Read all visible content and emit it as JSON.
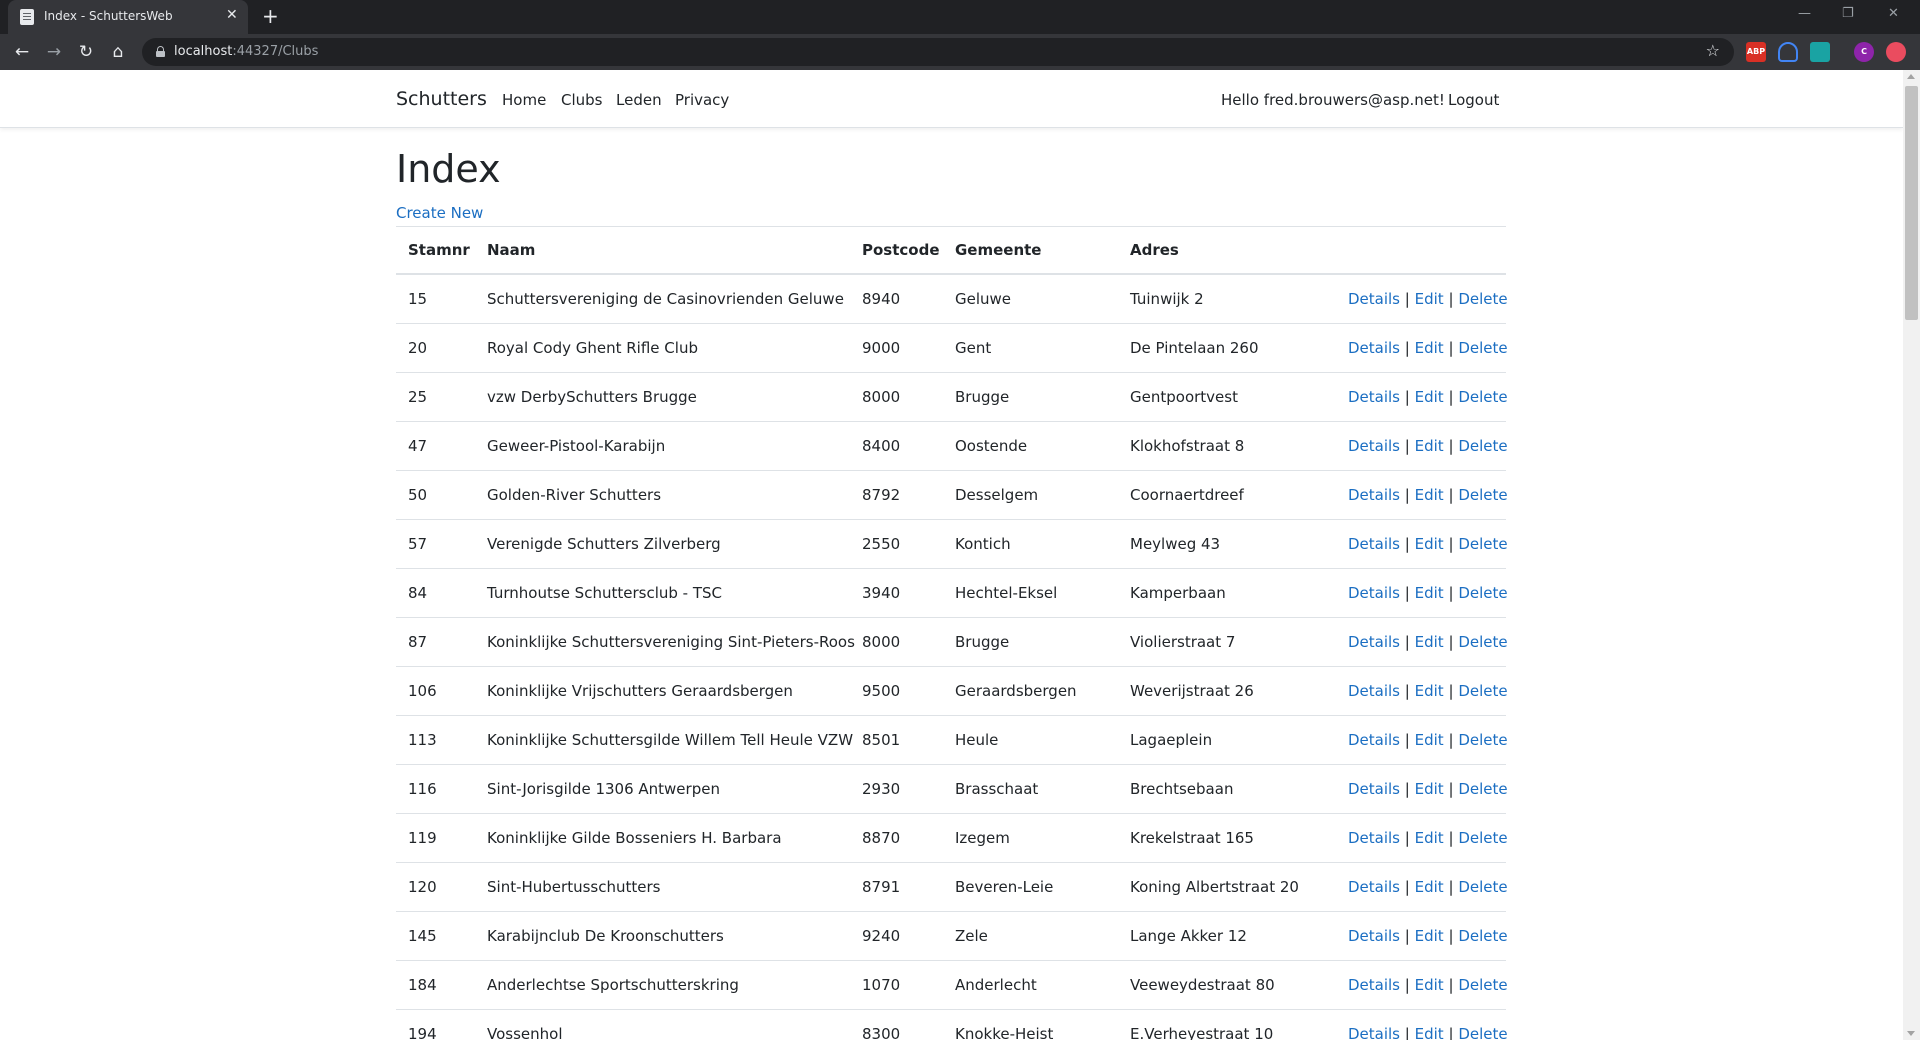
{
  "browser": {
    "tab_title": "Index - SchuttersWeb",
    "url_host": "localhost",
    "url_rest": ":44327/Clubs",
    "extensions": [
      "abp-icon",
      "ghostery-icon",
      "bookmark-ext-icon",
      "profile-avatar",
      "extension-red-icon"
    ],
    "profile_initial": "C",
    "abp_label": "ABP"
  },
  "navbar": {
    "brand": "Schutters",
    "links": [
      "Home",
      "Clubs",
      "Leden",
      "Privacy"
    ],
    "greeting": "Hello fred.brouwers@asp.net!",
    "logout": "Logout"
  },
  "main": {
    "title": "Index",
    "create_new": "Create New",
    "columns": [
      "Stamnr",
      "Naam",
      "Postcode",
      "Gemeente",
      "Adres"
    ],
    "actions": [
      "Details",
      "Edit",
      "Delete"
    ],
    "action_separator": "|",
    "rows": [
      {
        "stamnr": "15",
        "naam": "Schuttersvereniging de Casinovrienden Geluwe",
        "postcode": "8940",
        "gemeente": "Geluwe",
        "adres": "Tuinwijk 2"
      },
      {
        "stamnr": "20",
        "naam": "Royal Cody Ghent Rifle Club",
        "postcode": "9000",
        "gemeente": "Gent",
        "adres": "De Pintelaan 260"
      },
      {
        "stamnr": "25",
        "naam": "vzw DerbySchutters Brugge",
        "postcode": "8000",
        "gemeente": "Brugge",
        "adres": "Gentpoortvest"
      },
      {
        "stamnr": "47",
        "naam": "Geweer-Pistool-Karabijn",
        "postcode": "8400",
        "gemeente": "Oostende",
        "adres": "Klokhofstraat 8"
      },
      {
        "stamnr": "50",
        "naam": "Golden-River Schutters",
        "postcode": "8792",
        "gemeente": "Desselgem",
        "adres": "Coornaertdreef"
      },
      {
        "stamnr": "57",
        "naam": "Verenigde Schutters Zilverberg",
        "postcode": "2550",
        "gemeente": "Kontich",
        "adres": "Meylweg 43"
      },
      {
        "stamnr": "84",
        "naam": "Turnhoutse Schuttersclub - TSC",
        "postcode": "3940",
        "gemeente": "Hechtel-Eksel",
        "adres": "Kamperbaan"
      },
      {
        "stamnr": "87",
        "naam": "Koninklijke Schuttersvereniging Sint-Pieters-Roos",
        "postcode": "8000",
        "gemeente": "Brugge",
        "adres": "Violierstraat 7"
      },
      {
        "stamnr": "106",
        "naam": "Koninklijke Vrijschutters Geraardsbergen",
        "postcode": "9500",
        "gemeente": "Geraardsbergen",
        "adres": "Weverijstraat 26"
      },
      {
        "stamnr": "113",
        "naam": "Koninklijke Schuttersgilde Willem Tell Heule VZW",
        "postcode": "8501",
        "gemeente": "Heule",
        "adres": "Lagaeplein"
      },
      {
        "stamnr": "116",
        "naam": "Sint-Jorisgilde 1306 Antwerpen",
        "postcode": "2930",
        "gemeente": "Brasschaat",
        "adres": "Brechtsebaan"
      },
      {
        "stamnr": "119",
        "naam": "Koninklijke Gilde Bosseniers H. Barbara",
        "postcode": "8870",
        "gemeente": "Izegem",
        "adres": "Krekelstraat 165"
      },
      {
        "stamnr": "120",
        "naam": "Sint-Hubertusschutters",
        "postcode": "8791",
        "gemeente": "Beveren-Leie",
        "adres": "Koning Albertstraat 20"
      },
      {
        "stamnr": "145",
        "naam": "Karabijnclub De Kroonschutters",
        "postcode": "9240",
        "gemeente": "Zele",
        "adres": "Lange Akker 12"
      },
      {
        "stamnr": "184",
        "naam": "Anderlechtse Sportschutterskring",
        "postcode": "1070",
        "gemeente": "Anderlecht",
        "adres": "Veeweydestraat 80"
      },
      {
        "stamnr": "194",
        "naam": "Vossenhol",
        "postcode": "8300",
        "gemeente": "Knokke-Heist",
        "adres": "E.Verheyestraat 10"
      }
    ]
  },
  "colors": {
    "link": "#1b6ec2",
    "text": "#212529",
    "border": "#dee2e6",
    "chrome_dark": "#202124",
    "chrome_toolbar": "#35363a"
  }
}
